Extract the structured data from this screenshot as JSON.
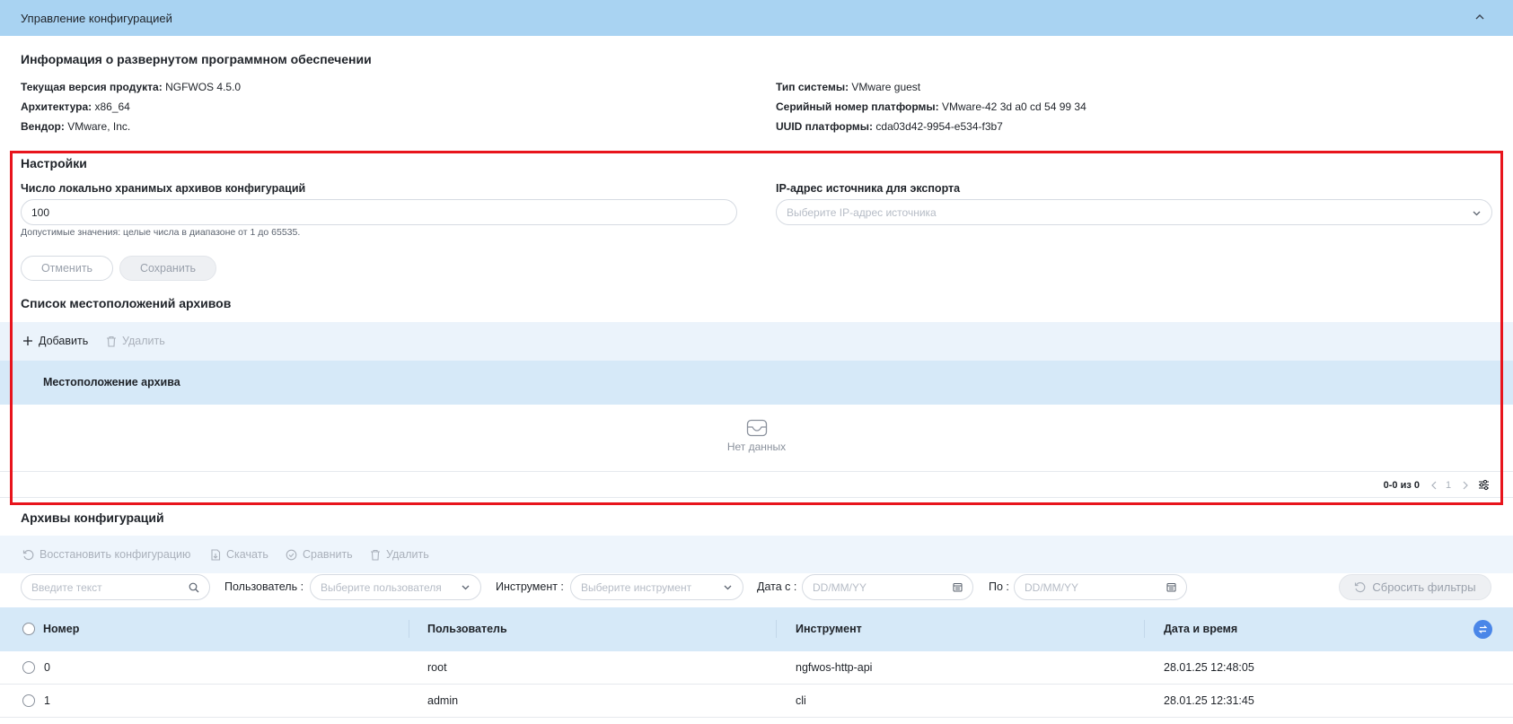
{
  "topbar": {
    "title": "Управление конфигурацией"
  },
  "software_info": {
    "heading": "Информация о развернутом программном обеспечении",
    "left": [
      {
        "label": "Текущая версия продукта:",
        "value": "NGFWOS 4.5.0"
      },
      {
        "label": "Архитектура:",
        "value": "x86_64"
      },
      {
        "label": "Вендор:",
        "value": "VMware, Inc."
      }
    ],
    "right": [
      {
        "label": "Тип системы:",
        "value": "VMware guest"
      },
      {
        "label": "Серийный номер платформы:",
        "value": "VMware-42 3d a0 cd 54 99 34"
      },
      {
        "label": "UUID платформы:",
        "value": "cda03d42-9954-e534-f3b7"
      }
    ]
  },
  "settings": {
    "heading": "Настройки",
    "archives_count": {
      "label": "Число локально хранимых архивов конфигураций",
      "value": "100",
      "hint": "Допустимые значения: целые числа в диапазоне от 1 до 65535."
    },
    "export_ip": {
      "label": "IP-адрес источника для экспорта",
      "placeholder": "Выберите IP-адрес источника"
    },
    "cancel_label": "Отменить",
    "save_label": "Сохранить"
  },
  "locations": {
    "heading": "Список местоположений архивов",
    "add_label": "Добавить",
    "delete_label": "Удалить",
    "column": "Местоположение архива",
    "empty_text": "Нет данных",
    "pager": {
      "count": "0-0 из 0",
      "page": "1"
    }
  },
  "archives": {
    "heading": "Архивы конфигураций",
    "toolbar": {
      "restore": "Восстановить конфигурацию",
      "download": "Скачать",
      "compare": "Сравнить",
      "delete": "Удалить"
    },
    "filters": {
      "search_placeholder": "Введите текст",
      "user_label": "Пользователь :",
      "user_placeholder": "Выберите пользователя",
      "tool_label": "Инструмент :",
      "tool_placeholder": "Выберите инструмент",
      "date_from_label": "Дата с :",
      "date_from_placeholder": "DD/MM/YY",
      "date_to_label": "По :",
      "date_to_placeholder": "DD/MM/YY",
      "reset_label": "Сбросить фильтры"
    },
    "columns": [
      "Номер",
      "Пользователь",
      "Инструмент",
      "Дата и время"
    ],
    "rows": [
      {
        "number": "0",
        "user": "root",
        "tool": "ngfwos-http-api",
        "datetime": "28.01.25 12:48:05"
      },
      {
        "number": "1",
        "user": "admin",
        "tool": "cli",
        "datetime": "28.01.25 12:31:45"
      }
    ]
  },
  "colors": {
    "accent": "#4a86e8",
    "highlight_box": "#e8141c",
    "header_bg": "#a9d3f2"
  }
}
